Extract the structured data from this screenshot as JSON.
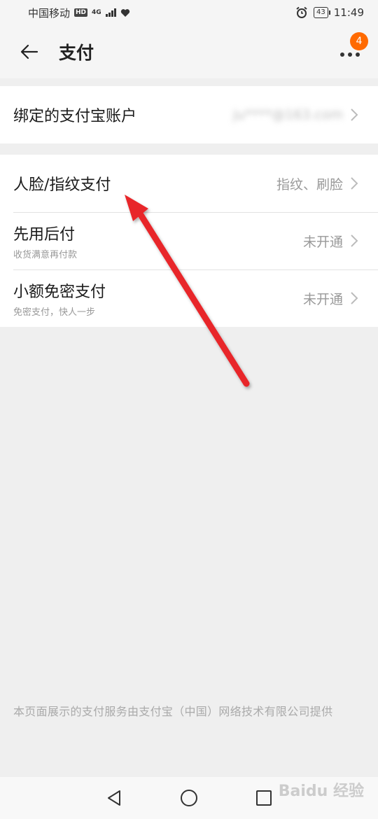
{
  "status_bar": {
    "carrier": "中国移动",
    "hd": "HD",
    "network": "4G",
    "battery": "43",
    "time": "11:49"
  },
  "header": {
    "title": "支付",
    "back_icon": "arrow-left-icon",
    "more_icon": "more-dots-icon",
    "badge_count": "4"
  },
  "sections": [
    {
      "rows": [
        {
          "title": "绑定的支付宝账户",
          "subtitle": "",
          "value": "ju****@163.com"
        }
      ]
    },
    {
      "rows": [
        {
          "title": "人脸/指纹支付",
          "subtitle": "",
          "value": "指纹、刷脸"
        },
        {
          "title": "先用后付",
          "subtitle": "收货满意再付款",
          "value": "未开通"
        },
        {
          "title": "小额免密支付",
          "subtitle": "免密支付，快人一步",
          "value": "未开通"
        }
      ]
    }
  ],
  "footer_note": "本页面展示的支付服务由支付宝（中国）网络技术有限公司提供",
  "nav": {
    "back_icon": "triangle-back-icon",
    "home_icon": "circle-home-icon",
    "recent_icon": "square-recent-icon"
  },
  "watermark": "Baidu 经验",
  "colors": {
    "accent": "#ff6a00",
    "annotation_arrow": "#e8282b"
  }
}
